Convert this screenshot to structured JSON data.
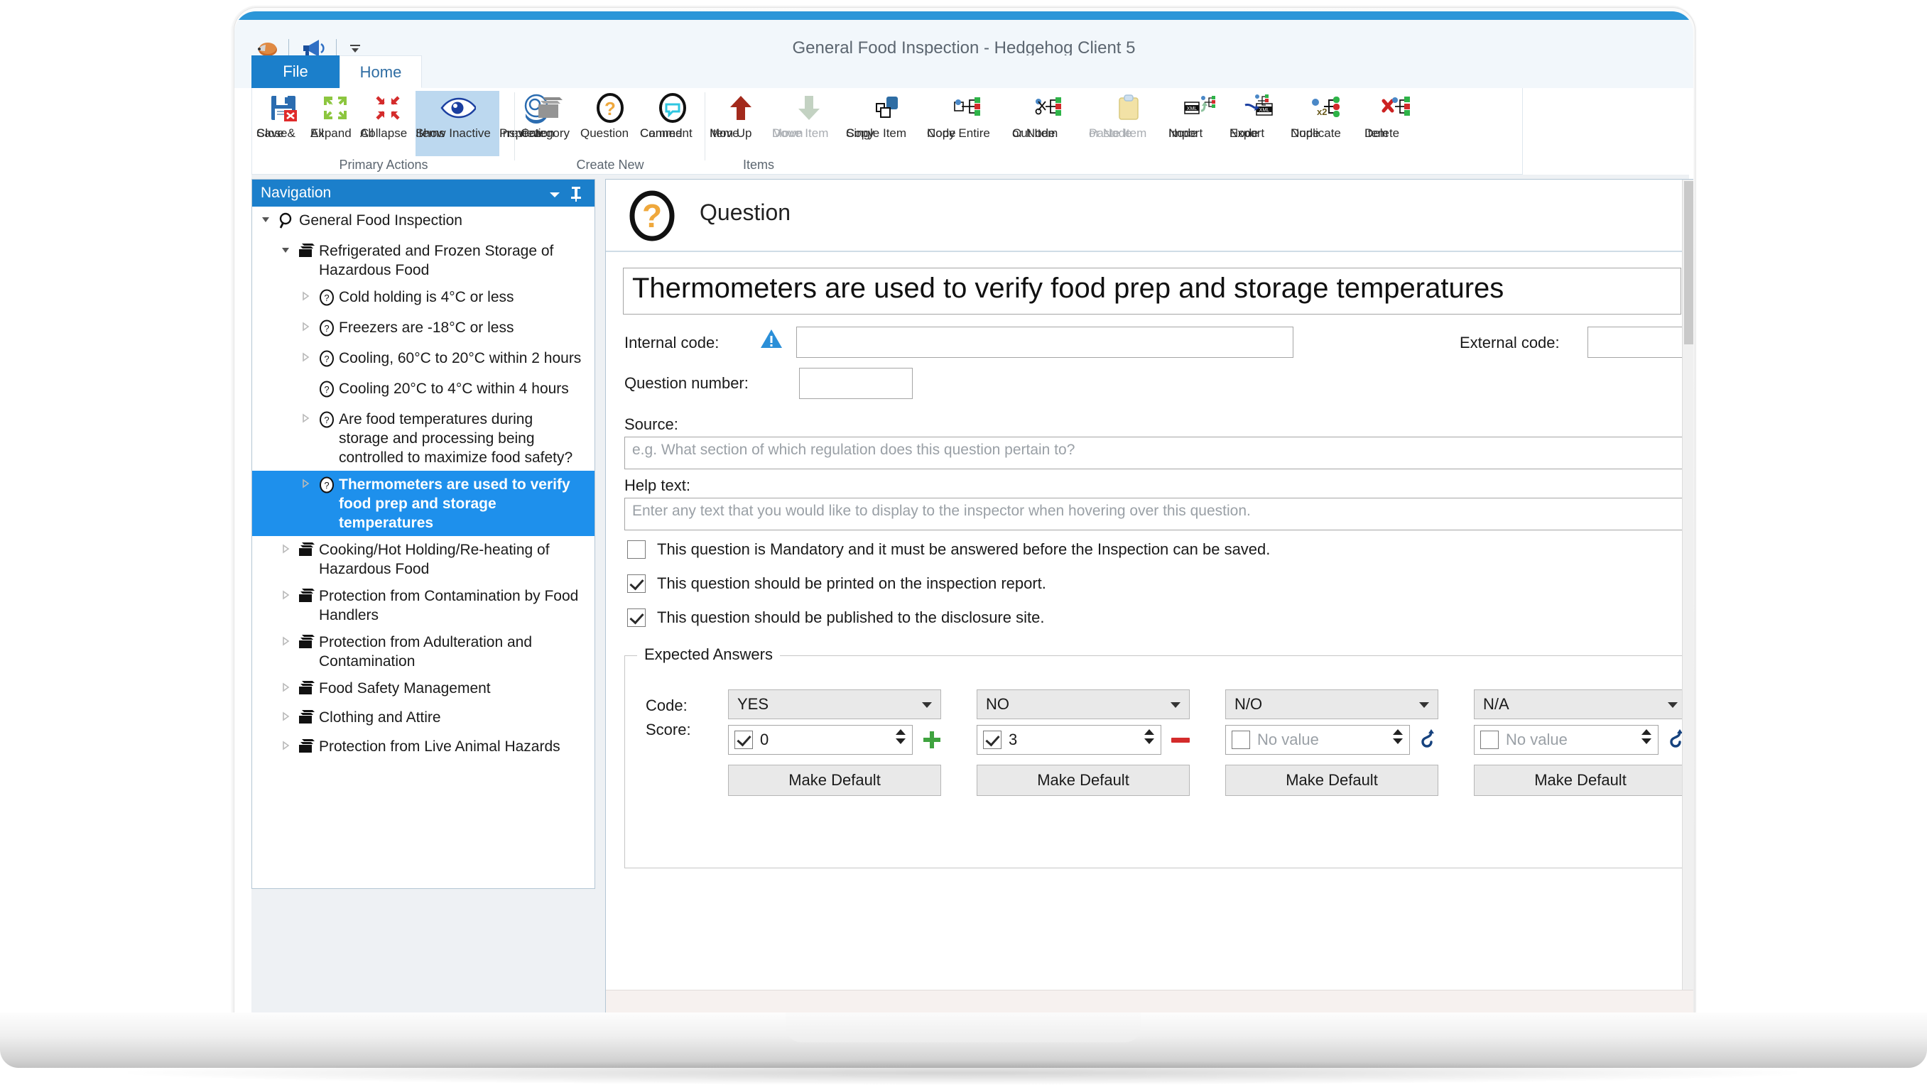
{
  "window": {
    "title": "General Food Inspection - Hedgehog Client 5",
    "quick_access": [
      "hedgehog-icon",
      "megaphone-icon",
      "customize-qat-icon"
    ]
  },
  "tabs": [
    {
      "label": "File",
      "active": false
    },
    {
      "label": "Home",
      "active": true
    }
  ],
  "ribbon": {
    "groups": [
      {
        "title": "Primary Actions",
        "buttons": [
          {
            "label_line1": "Save &",
            "label_line2": "Close",
            "icon": "save-close-icon",
            "disabled": false,
            "active": false
          },
          {
            "label_line1": "Expand",
            "label_line2": "All",
            "icon": "expand-all-icon",
            "disabled": false,
            "active": false
          },
          {
            "label_line1": "Collapse",
            "label_line2": "All",
            "icon": "collapse-all-icon",
            "disabled": false,
            "active": false
          },
          {
            "label_line1": "Show Inactive",
            "label_line2": "Items",
            "icon": "eye-icon",
            "disabled": false,
            "active": true
          },
          {
            "label_line1": "Preview",
            "label_line2": "Inspection",
            "icon": "preview-inspection-icon",
            "disabled": false,
            "active": false
          }
        ]
      },
      {
        "title": "Create New",
        "buttons": [
          {
            "label_line1": "Category",
            "label_line2": "",
            "icon": "category-icon",
            "disabled": false,
            "active": false
          },
          {
            "label_line1": "Question",
            "label_line2": "",
            "icon": "question-icon",
            "disabled": false,
            "active": false
          },
          {
            "label_line1": "Canned",
            "label_line2": "Comment",
            "icon": "canned-comment-icon",
            "disabled": false,
            "active": false
          }
        ]
      },
      {
        "title": "Items",
        "buttons": [
          {
            "label_line1": "Move",
            "label_line2": "Item Up",
            "icon": "arrow-up-icon",
            "disabled": false,
            "active": false
          },
          {
            "label_line1": "Move Item",
            "label_line2": "Down",
            "icon": "arrow-down-icon",
            "disabled": true,
            "active": false
          },
          {
            "label_line1": "Copy",
            "label_line2": "Single Item",
            "icon": "copy-single-item-icon",
            "disabled": false,
            "active": false
          },
          {
            "label_line1": "Copy Entire",
            "label_line2": "Node",
            "icon": "copy-node-icon",
            "disabled": false,
            "active": false
          },
          {
            "label_line1": "Cut Item",
            "label_line2": "or Node",
            "icon": "cut-node-icon",
            "disabled": false,
            "active": false
          },
          {
            "label_line1": "Paste Item",
            "label_line2": "or Node",
            "icon": "clipboard-paste-icon",
            "disabled": true,
            "active": false
          },
          {
            "label_line1": "Import",
            "label_line2": "Node",
            "icon": "import-xml-icon",
            "disabled": false,
            "active": false
          },
          {
            "label_line1": "Export",
            "label_line2": "Node",
            "icon": "export-xml-icon",
            "disabled": false,
            "active": false
          },
          {
            "label_line1": "Duplicate",
            "label_line2": "Node",
            "icon": "duplicate-node-icon",
            "disabled": false,
            "active": false
          },
          {
            "label_line1": "Delete",
            "label_line2": "Item",
            "icon": "delete-item-icon",
            "disabled": false,
            "active": false
          }
        ]
      }
    ]
  },
  "navigation": {
    "header": "Navigation",
    "tree": [
      {
        "label": "General Food Inspection",
        "icon": "magnifier-icon",
        "indent": 0,
        "expander": "expanded",
        "selected": false
      },
      {
        "label": "Refrigerated and Frozen Storage of Hazardous Food",
        "icon": "category-icon",
        "indent": 1,
        "expander": "expanded",
        "selected": false
      },
      {
        "label": "Cold holding is 4°C or less",
        "icon": "question-icon",
        "indent": 2,
        "expander": "collapsed",
        "selected": false
      },
      {
        "label": "Freezers are -18°C or less",
        "icon": "question-icon",
        "indent": 2,
        "expander": "collapsed",
        "selected": false
      },
      {
        "label": "Cooling, 60°C to 20°C within 2 hours",
        "icon": "question-icon",
        "indent": 2,
        "expander": "collapsed",
        "selected": false
      },
      {
        "label": "Cooling 20°C to 4°C within 4 hours",
        "icon": "question-icon",
        "indent": 2,
        "expander": "none",
        "selected": false
      },
      {
        "label": "Are food temperatures during storage and processing being controlled to maximize food safety?",
        "icon": "question-icon",
        "indent": 2,
        "expander": "collapsed",
        "selected": false
      },
      {
        "label": "Thermometers are used to verify food prep and storage temperatures",
        "icon": "question-icon",
        "indent": 2,
        "expander": "collapsed",
        "selected": true
      },
      {
        "label": "Cooking/Hot Holding/Re-heating of Hazardous Food",
        "icon": "category-icon",
        "indent": 1,
        "expander": "collapsed",
        "selected": false
      },
      {
        "label": "Protection from Contamination by Food Handlers",
        "icon": "category-icon",
        "indent": 1,
        "expander": "collapsed",
        "selected": false
      },
      {
        "label": "Protection from Adulteration and Contamination",
        "icon": "category-icon",
        "indent": 1,
        "expander": "collapsed",
        "selected": false
      },
      {
        "label": "Food Safety Management",
        "icon": "category-icon",
        "indent": 1,
        "expander": "collapsed",
        "selected": false
      },
      {
        "label": "Clothing and Attire",
        "icon": "category-icon",
        "indent": 1,
        "expander": "collapsed",
        "selected": false
      },
      {
        "label": "Protection from Live Animal Hazards",
        "icon": "category-icon",
        "indent": 1,
        "expander": "collapsed",
        "selected": false
      }
    ]
  },
  "detail": {
    "header_title": "Question",
    "header_icon": "question-icon",
    "question_text": "Thermometers are used to verify food prep and storage temperatures",
    "internal_code": {
      "label": "Internal code:",
      "value": "",
      "warning_icon": "warning-triangle-icon"
    },
    "external_code": {
      "label": "External code:",
      "value": ""
    },
    "question_number": {
      "label": "Question number:",
      "value": ""
    },
    "source": {
      "label": "Source:",
      "value": "",
      "placeholder": "e.g. What section of which regulation does this question pertain to?"
    },
    "help_text": {
      "label": "Help text:",
      "value": "",
      "placeholder": "Enter any text that you would like to display to the inspector when hovering over this question."
    },
    "checkboxes": [
      {
        "label": "This question is Mandatory and it must be answered before the Inspection can be saved.",
        "checked": false
      },
      {
        "label": "This question should be printed on the inspection report.",
        "checked": true
      },
      {
        "label": "This question should be published to the disclosure site.",
        "checked": true
      }
    ],
    "expected_answers": {
      "legend": "Expected Answers",
      "code_label": "Code:",
      "score_label": "Score:",
      "make_default_label": "Make Default",
      "columns": [
        {
          "code": "YES",
          "score_checked": true,
          "score_value": "0",
          "score_placeholder": "",
          "action_icon": "plus-icon"
        },
        {
          "code": "NO",
          "score_checked": true,
          "score_value": "3",
          "score_placeholder": "",
          "action_icon": "minus-icon"
        },
        {
          "code": "N/O",
          "score_checked": false,
          "score_value": "",
          "score_placeholder": "No value",
          "action_icon": "undo-icon"
        },
        {
          "code": "N/A",
          "score_checked": false,
          "score_value": "",
          "score_placeholder": "No value",
          "action_icon": "undo-icon"
        }
      ]
    }
  }
}
